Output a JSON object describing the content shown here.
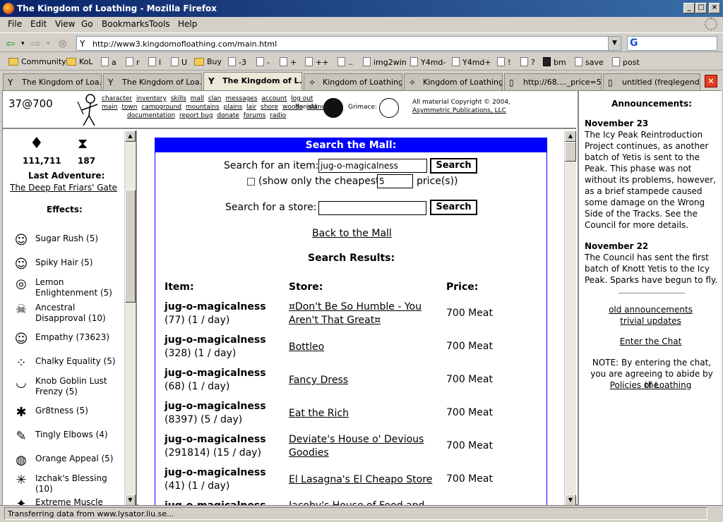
{
  "window": {
    "title": "The Kingdom of Loathing - Mozilla Firefox",
    "min": "_",
    "max": "□",
    "close": "×"
  },
  "menu": [
    "File",
    "Edit",
    "View",
    "Go",
    "Bookmarks",
    "Tools",
    "Help"
  ],
  "nav": {
    "url": "http://www3.kingdomofloathing.com/main.html"
  },
  "bookmarks": [
    {
      "label": "Community",
      "icon": "folder"
    },
    {
      "label": "KoL",
      "icon": "folder"
    },
    {
      "label": "a",
      "icon": "page"
    },
    {
      "label": "r",
      "icon": "page"
    },
    {
      "label": "l",
      "icon": "page"
    },
    {
      "label": "U",
      "icon": "page"
    },
    {
      "label": "Buy",
      "icon": "folder"
    },
    {
      "label": "-3",
      "icon": "page"
    },
    {
      "label": "-",
      "icon": "page"
    },
    {
      "label": "+",
      "icon": "page"
    },
    {
      "label": "++",
      "icon": "page"
    },
    {
      "label": "..",
      "icon": "page"
    },
    {
      "label": "img2win",
      "icon": "page"
    },
    {
      "label": "Y4md-",
      "icon": "page"
    },
    {
      "label": "Y4md+",
      "icon": "page"
    },
    {
      "label": "!",
      "icon": "page"
    },
    {
      "label": "?",
      "icon": "page"
    },
    {
      "label": "bm",
      "icon": "page"
    },
    {
      "label": "save",
      "icon": "page"
    },
    {
      "label": "post",
      "icon": "page"
    }
  ],
  "tabs": [
    {
      "label": "The Kingdom of Loa...",
      "active": false,
      "icon": "Y"
    },
    {
      "label": "The Kingdom of Loa...",
      "active": false,
      "icon": "Y"
    },
    {
      "label": "The Kingdom of L...",
      "active": true,
      "icon": "Y"
    },
    {
      "label": "Kingdom of Loathing...",
      "active": false,
      "icon": "✧"
    },
    {
      "label": "Kingdom of Loathing...",
      "active": false,
      "icon": "✧"
    },
    {
      "label": "http://68...._price=58",
      "active": false,
      "icon": "▯"
    },
    {
      "label": "untitled (freqlegend...",
      "active": false,
      "icon": "▯"
    }
  ],
  "topframe": {
    "stat": "37@700",
    "links_row1": [
      "character",
      "inventory",
      "skills",
      "mall",
      "clan",
      "messages",
      "account",
      "log out"
    ],
    "links_row2": [
      "main",
      "town",
      "campground",
      "mountains",
      "plains",
      "lair",
      "shore",
      "woods",
      "island"
    ],
    "links_row3": [
      "documentation",
      "report bug",
      "donate",
      "forums",
      "radio"
    ],
    "moon1": "Ronald:",
    "moon2": "Grimace:",
    "copyright1": "All material Copyright © 2004,",
    "copyright2": "Asymmetric Publications, LLC"
  },
  "sidebar": {
    "meat": "111,711",
    "adventures": "187",
    "last_adventure_label": "Last Adventure:",
    "last_adventure": "The Deep Fat Friars' Gate",
    "effects_label": "Effects:",
    "effects": [
      {
        "name": "Sugar Rush (5)",
        "icon": "☺"
      },
      {
        "name": "Spiky Hair (5)",
        "icon": "☺"
      },
      {
        "name": "Lemon Enlightenment (5)",
        "icon": "◎"
      },
      {
        "name": "Ancestral Disapproval (10)",
        "icon": "☠"
      },
      {
        "name": "Empathy (73623)",
        "icon": "☺"
      },
      {
        "name": "Chalky Equality (5)",
        "icon": "⁘"
      },
      {
        "name": "Knob Goblin Lust Frenzy (5)",
        "icon": "◡"
      },
      {
        "name": "Gr8tness (5)",
        "icon": "✱"
      },
      {
        "name": "Tingly Elbows (4)",
        "icon": "✎"
      },
      {
        "name": "Orange Appeal (5)",
        "icon": "◍"
      },
      {
        "name": "Izchak's Blessing (10)",
        "icon": "✳"
      },
      {
        "name": "Extreme Muscle",
        "icon": "✦"
      }
    ]
  },
  "mall": {
    "header": "Search the Mall:",
    "item_label": "Search for an item:",
    "item_value": "jug-o-magicalness",
    "search_btn": "Search",
    "cheapest_pre": "(show only the cheapest",
    "cheapest_value": "5",
    "cheapest_post": "price(s))",
    "store_label": "Search for a store:",
    "store_value": "",
    "back": "Back to the Mall",
    "results_title": "Search Results:",
    "col_item": "Item:",
    "col_store": "Store:",
    "col_price": "Price:",
    "rows": [
      {
        "item": "jug-o-magicalness",
        "detail": "(77) (1 / day)",
        "store": "¤Don't Be So Humble - You Aren't That Great¤",
        "price": "700 Meat"
      },
      {
        "item": "jug-o-magicalness",
        "detail": "(328) (1 / day)",
        "store": "Bottleo",
        "price": "700 Meat"
      },
      {
        "item": "jug-o-magicalness",
        "detail": "(68) (1 / day)",
        "store": "Fancy Dress",
        "price": "700 Meat"
      },
      {
        "item": "jug-o-magicalness",
        "detail": "(8397) (5 / day)",
        "store": "Eat the Rich",
        "price": "700 Meat"
      },
      {
        "item": "jug-o-magicalness",
        "detail": "(291814) (15 / day)",
        "store": "Deviate's House o' Devious Goodies",
        "price": "700 Meat"
      },
      {
        "item": "jug-o-magicalness",
        "detail": "(41) (1 / day)",
        "store": "El Lasagna's El Cheapo Store",
        "price": "700 Meat"
      },
      {
        "item": "jug-o-magicalness",
        "detail": "",
        "store": "Jacoby's House of Food and",
        "price": ""
      }
    ]
  },
  "announcements": {
    "title": "Announcements:",
    "date1": "November 23",
    "text1": "The Icy Peak Reintroduction Project continues, as another batch of Yetis is sent to the Peak. This phase was not without its problems, however, as a brief stampede caused some damage on the Wrong Side of the Tracks. See the Council for more details.",
    "date2": "November 22",
    "text2": "The Council has sent the first batch of Knott Yetis to the Icy Peak. Sparks have begun to fly.",
    "old": "old announcements",
    "trivial": "trivial updates",
    "chat": "Enter the Chat",
    "note": "NOTE: By entering the chat, you are agreeing to abide by the",
    "policies": "Policies of Loathing"
  },
  "status": "Transferring data from www.lysator.liu.se..."
}
